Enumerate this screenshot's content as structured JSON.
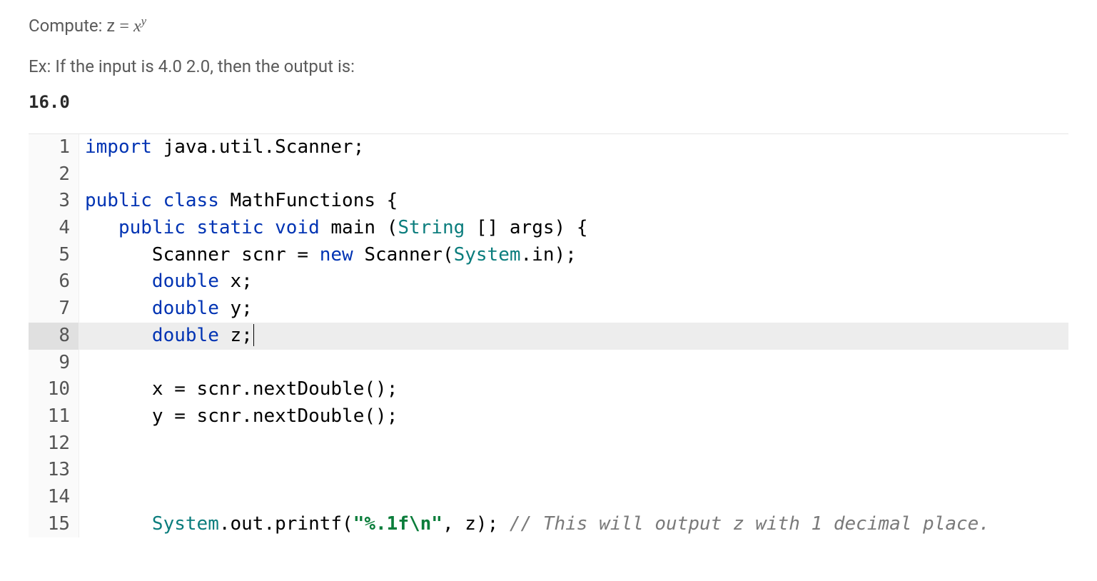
{
  "problem": {
    "prefix": "Compute: ",
    "eq_lhs": "z",
    "eq_rhs_base": "x",
    "eq_rhs_exp": "y"
  },
  "example": {
    "label": "Ex: If the input is 4.0 2.0, then the output is:",
    "output": "16.0"
  },
  "code": {
    "lines": [
      {
        "n": "1",
        "tokens": [
          [
            "keyword",
            "import"
          ],
          [
            "name",
            " java"
          ],
          [
            "punct",
            "."
          ],
          [
            "name",
            "util"
          ],
          [
            "punct",
            "."
          ],
          [
            "name",
            "Scanner"
          ],
          [
            "punct",
            ";"
          ]
        ]
      },
      {
        "n": "2",
        "tokens": []
      },
      {
        "n": "3",
        "tokens": [
          [
            "keyword",
            "public"
          ],
          [
            "name",
            " "
          ],
          [
            "keyword",
            "class"
          ],
          [
            "name",
            " "
          ],
          [
            "class",
            "MathFunctions"
          ],
          [
            "name",
            " "
          ],
          [
            "punct",
            "{"
          ]
        ]
      },
      {
        "n": "4",
        "indent": "   ",
        "tokens": [
          [
            "keyword",
            "public"
          ],
          [
            "name",
            " "
          ],
          [
            "keyword",
            "static"
          ],
          [
            "name",
            " "
          ],
          [
            "keyword",
            "void"
          ],
          [
            "name",
            " "
          ],
          [
            "method",
            "main"
          ],
          [
            "name",
            " "
          ],
          [
            "punct",
            "("
          ],
          [
            "builtin",
            "String"
          ],
          [
            "name",
            " "
          ],
          [
            "punct",
            "[]"
          ],
          [
            "name",
            " args"
          ],
          [
            "punct",
            ")"
          ],
          [
            "name",
            " "
          ],
          [
            "punct",
            "{"
          ]
        ]
      },
      {
        "n": "5",
        "indent": "      ",
        "tokens": [
          [
            "name",
            "Scanner scnr "
          ],
          [
            "op",
            "="
          ],
          [
            "name",
            " "
          ],
          [
            "keyword",
            "new"
          ],
          [
            "name",
            " "
          ],
          [
            "class",
            "Scanner"
          ],
          [
            "punct",
            "("
          ],
          [
            "builtin",
            "System"
          ],
          [
            "punct",
            "."
          ],
          [
            "name",
            "in"
          ],
          [
            "punct",
            ")"
          ],
          [
            "punct",
            ";"
          ]
        ]
      },
      {
        "n": "6",
        "indent": "      ",
        "tokens": [
          [
            "keyword",
            "double"
          ],
          [
            "name",
            " x"
          ],
          [
            "punct",
            ";"
          ]
        ]
      },
      {
        "n": "7",
        "indent": "      ",
        "tokens": [
          [
            "keyword",
            "double"
          ],
          [
            "name",
            " y"
          ],
          [
            "punct",
            ";"
          ]
        ]
      },
      {
        "n": "8",
        "indent": "      ",
        "hl": true,
        "cursor": true,
        "tokens": [
          [
            "keyword",
            "double"
          ],
          [
            "name",
            " z"
          ],
          [
            "punct",
            ";"
          ]
        ]
      },
      {
        "n": "9",
        "tokens": []
      },
      {
        "n": "10",
        "indent": "      ",
        "tokens": [
          [
            "name",
            "x "
          ],
          [
            "op",
            "="
          ],
          [
            "name",
            " scnr"
          ],
          [
            "punct",
            "."
          ],
          [
            "method",
            "nextDouble"
          ],
          [
            "punct",
            "()"
          ],
          [
            "punct",
            ";"
          ]
        ]
      },
      {
        "n": "11",
        "indent": "      ",
        "tokens": [
          [
            "name",
            "y "
          ],
          [
            "op",
            "="
          ],
          [
            "name",
            " scnr"
          ],
          [
            "punct",
            "."
          ],
          [
            "method",
            "nextDouble"
          ],
          [
            "punct",
            "()"
          ],
          [
            "punct",
            ";"
          ]
        ]
      },
      {
        "n": "12",
        "tokens": []
      },
      {
        "n": "13",
        "tokens": []
      },
      {
        "n": "14",
        "tokens": []
      },
      {
        "n": "15",
        "indent": "      ",
        "tokens": [
          [
            "builtin",
            "System"
          ],
          [
            "punct",
            "."
          ],
          [
            "name",
            "out"
          ],
          [
            "punct",
            "."
          ],
          [
            "method",
            "printf"
          ],
          [
            "punct",
            "("
          ],
          [
            "string2",
            "\"%.1f\\n\""
          ],
          [
            "punct",
            ","
          ],
          [
            "name",
            " z"
          ],
          [
            "punct",
            ")"
          ],
          [
            "punct",
            ";"
          ],
          [
            "name",
            " "
          ],
          [
            "comment",
            "// This will output z with 1 decimal place."
          ]
        ]
      }
    ]
  }
}
